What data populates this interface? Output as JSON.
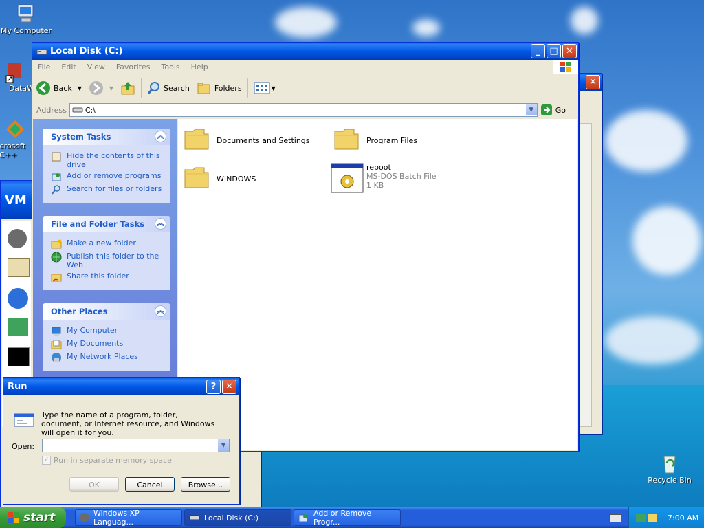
{
  "desktop_icons": [
    "My Computer",
    "DataWa",
    "Microsoft C++",
    "Recycle Bin"
  ],
  "explorer": {
    "title": "Local Disk (C:)",
    "menu": [
      "File",
      "Edit",
      "View",
      "Favorites",
      "Tools",
      "Help"
    ],
    "toolbar": {
      "back": "Back",
      "search": "Search",
      "folders": "Folders"
    },
    "address_label": "Address",
    "address_value": "C:\\",
    "go_label": "Go",
    "panels": [
      {
        "title": "System Tasks",
        "items": [
          "Hide the contents of this drive",
          "Add or remove programs",
          "Search for files or folders"
        ]
      },
      {
        "title": "File and Folder Tasks",
        "items": [
          "Make a new folder",
          "Publish this folder to the Web",
          "Share this folder"
        ]
      },
      {
        "title": "Other Places",
        "items": [
          "My Computer",
          "My Documents",
          "My Network Places"
        ]
      }
    ],
    "files": [
      {
        "name": "Documents and Settings"
      },
      {
        "name": "Program Files"
      },
      {
        "name": "WINDOWS"
      },
      {
        "name": "reboot",
        "type": "MS-DOS Batch File",
        "size": "1 KB"
      }
    ]
  },
  "behind_window": {
    "label": "VM"
  },
  "run_dialog": {
    "title": "Run",
    "description": "Type the name of a program, folder, document, or Internet resource, and Windows will open it for you.",
    "open_label": "Open:",
    "open_value": "",
    "checkbox_label": "Run in separate memory space",
    "ok": "OK",
    "cancel": "Cancel",
    "browse": "Browse..."
  },
  "taskbar": {
    "start": "start",
    "tasks": [
      "Windows XP Languag...",
      "Local Disk (C:)",
      "Add or Remove Progr..."
    ],
    "clock": "7:00 AM"
  }
}
